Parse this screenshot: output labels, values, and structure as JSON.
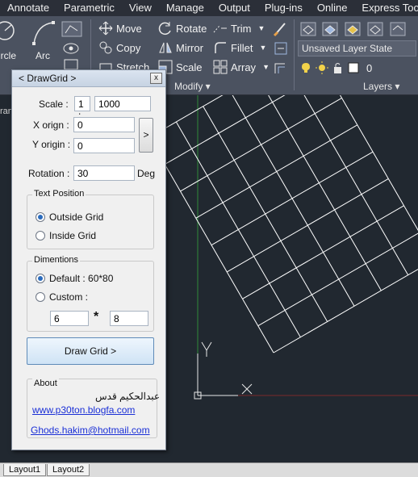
{
  "menubar": {
    "items": [
      "Annotate",
      "Parametric",
      "View",
      "Manage",
      "Output",
      "Plug-ins",
      "Online",
      "Express Tools"
    ]
  },
  "ribbon": {
    "draw": {
      "circle_label": "ircle",
      "arc_label": "Arc"
    },
    "modify": {
      "move": "Move",
      "rotate": "Rotate",
      "trim": "Trim",
      "copy": "Copy",
      "mirror": "Mirror",
      "fillet": "Fillet",
      "stretch": "Stretch",
      "scale": "Scale",
      "array": "Array",
      "panel_label": "Modify ▾"
    },
    "layers": {
      "layer_state": "Unsaved Layer State",
      "layer_value": "0",
      "panel_label": "Layers ▾"
    }
  },
  "dialog": {
    "title": "< DrawGrid >",
    "close": "x",
    "scale_label": "Scale :",
    "scale_prefix": "1 :",
    "scale_value": "1000",
    "x_origin_label": "X orign :",
    "x_origin_value": "0",
    "y_origin_label": "Y origin :",
    "y_origin_value": "0",
    "pick_button": ">",
    "rotation_label": "Rotation :",
    "rotation_value": "30",
    "rotation_unit": "Deg",
    "text_position": {
      "title": "Text Position",
      "outside": "Outside Grid",
      "inside": "Inside Grid",
      "selected": "Outside Grid"
    },
    "dimentions": {
      "title": "Dimentions",
      "default": "Default : 60*80",
      "custom": "Custom :",
      "selected": "Default : 60*80",
      "custom_x": "6",
      "times": "*",
      "custom_y": "8"
    },
    "draw_button": "Draw Grid >",
    "about": {
      "title": "About",
      "author": "عبدالحکیم قدس",
      "website": "www.p30ton.blogfa.com",
      "email": "Ghods.hakim@hotmail.com"
    }
  },
  "layout_tabs": [
    "Layout1",
    "Layout2"
  ],
  "canvas": {
    "side_text": "ran"
  },
  "colors": {
    "canvas_bg": "#212830",
    "grid_line": "#ffffff",
    "y_axis": "#2e8a3a",
    "x_axis": "#7a2a2a",
    "dialog_bg": "#f0f0f0"
  }
}
